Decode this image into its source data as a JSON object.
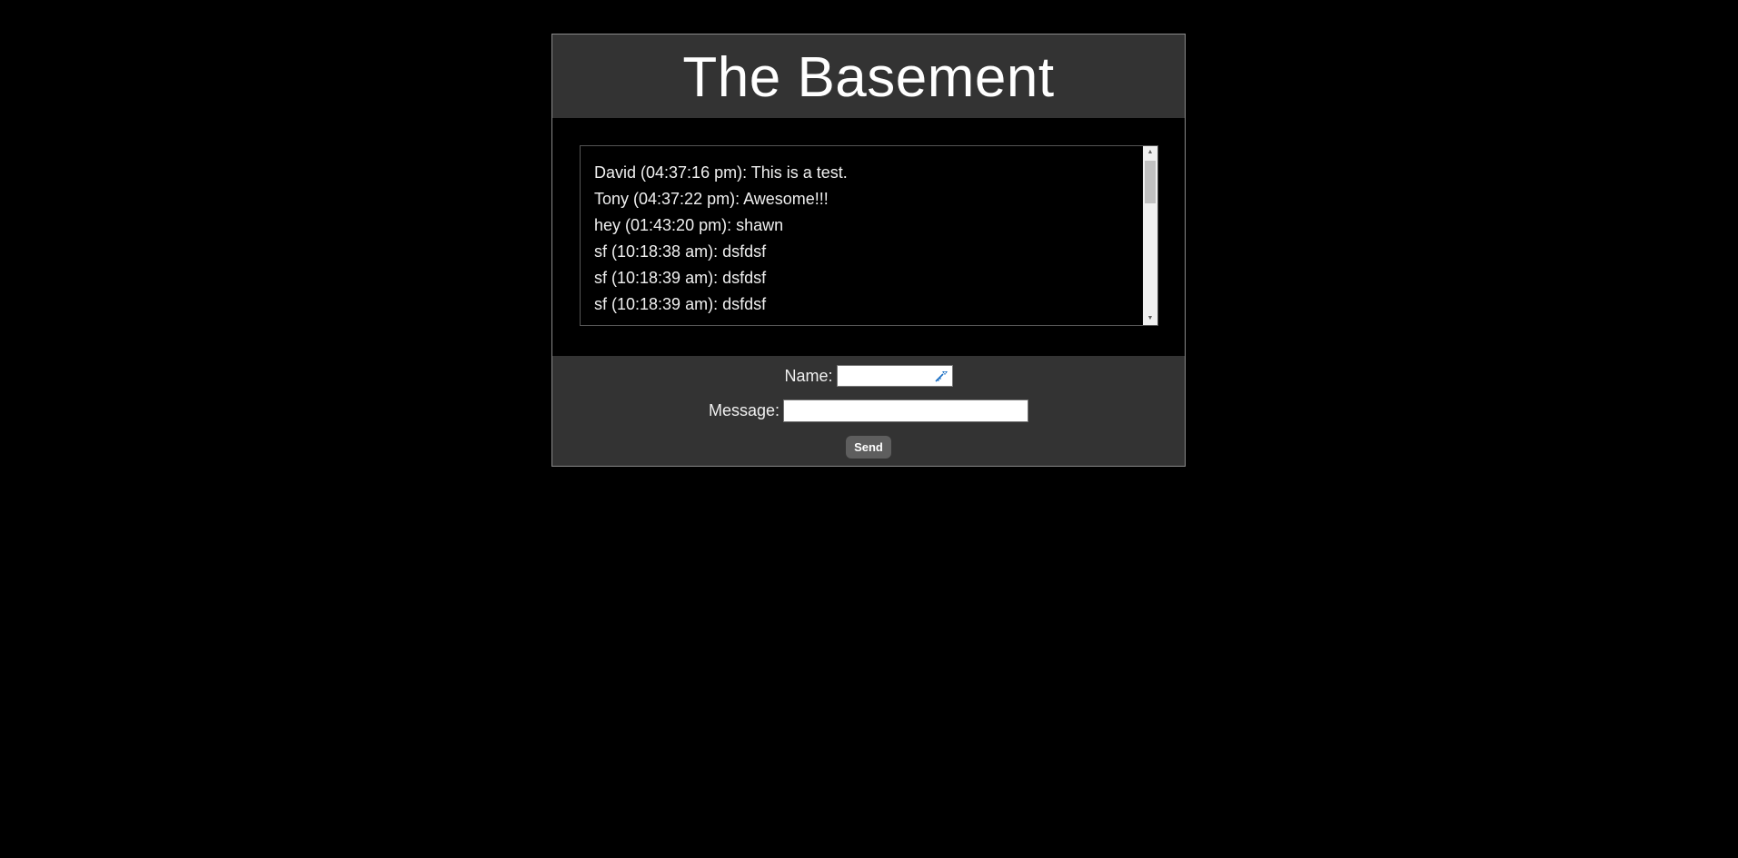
{
  "header": {
    "title": "The Basement"
  },
  "chat": {
    "messages": [
      "David (04:37:16 pm): This is a test.",
      "Tony (04:37:22 pm): Awesome!!!",
      "hey (01:43:20 pm): shawn",
      "sf (10:18:38 am): dsfdsf",
      "sf (10:18:39 am): dsfdsf",
      "sf (10:18:39 am): dsfdsf"
    ],
    "scrollbar": {
      "up_arrow": "▲",
      "down_arrow": "▼"
    }
  },
  "form": {
    "name_label": "Name:",
    "name_value": "",
    "message_label": "Message:",
    "message_value": "",
    "send_label": "Send"
  },
  "colors": {
    "page_background": "#000000",
    "panel_background": "#333333",
    "text": "#f0f0f0",
    "button": "#5e5e5e",
    "key_icon": "#1a6fc4"
  },
  "icons": {
    "password_manager": "key-icon"
  }
}
